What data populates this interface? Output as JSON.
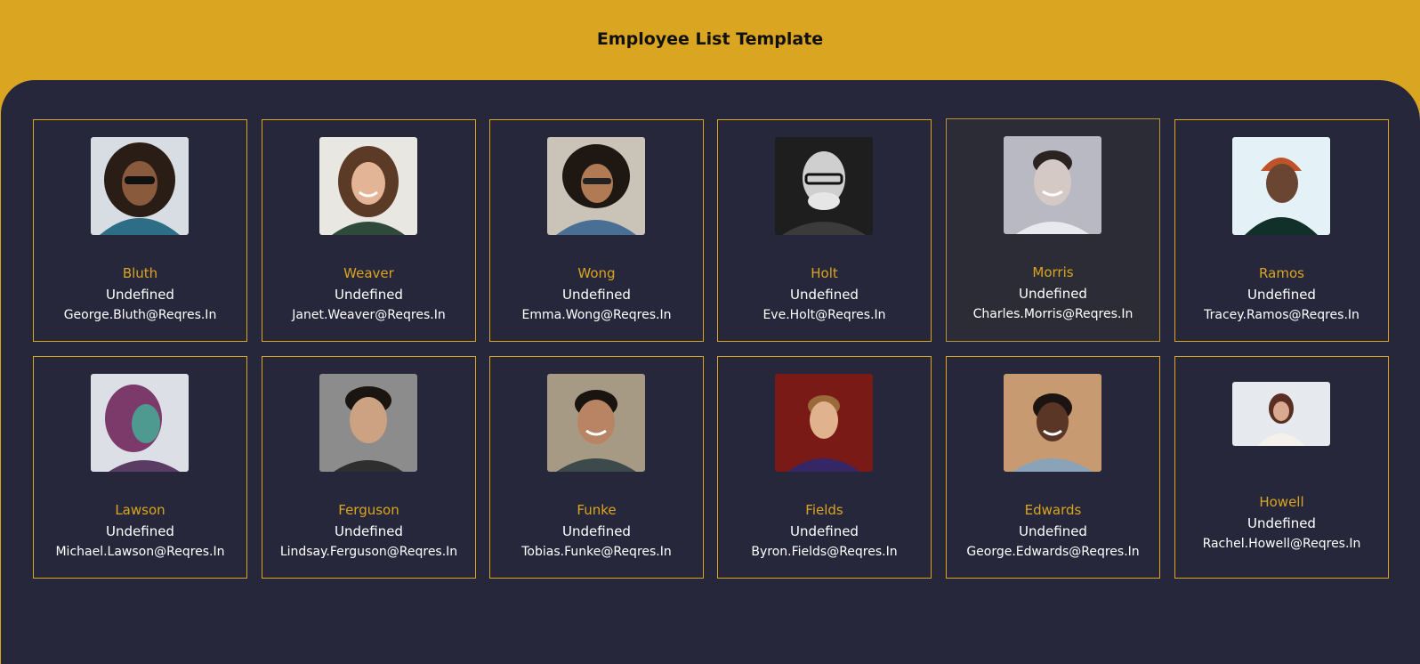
{
  "header": {
    "title": "Employee List Template"
  },
  "employees": [
    {
      "last_name": "Bluth",
      "role": "Undefined",
      "email": "George.Bluth@Reqres.In"
    },
    {
      "last_name": "Weaver",
      "role": "Undefined",
      "email": "Janet.Weaver@Reqres.In"
    },
    {
      "last_name": "Wong",
      "role": "Undefined",
      "email": "Emma.Wong@Reqres.In"
    },
    {
      "last_name": "Holt",
      "role": "Undefined",
      "email": "Eve.Holt@Reqres.In"
    },
    {
      "last_name": "Morris",
      "role": "Undefined",
      "email": "Charles.Morris@Reqres.In"
    },
    {
      "last_name": "Ramos",
      "role": "Undefined",
      "email": "Tracey.Ramos@Reqres.In"
    },
    {
      "last_name": "Lawson",
      "role": "Undefined",
      "email": "Michael.Lawson@Reqres.In"
    },
    {
      "last_name": "Ferguson",
      "role": "Undefined",
      "email": "Lindsay.Ferguson@Reqres.In"
    },
    {
      "last_name": "Funke",
      "role": "Undefined",
      "email": "Tobias.Funke@Reqres.In"
    },
    {
      "last_name": "Fields",
      "role": "Undefined",
      "email": "Byron.Fields@Reqres.In"
    },
    {
      "last_name": "Edwards",
      "role": "Undefined",
      "email": "George.Edwards@Reqres.In"
    },
    {
      "last_name": "Howell",
      "role": "Undefined",
      "email": "Rachel.Howell@Reqres.In"
    }
  ],
  "colors": {
    "accent": "#daa520",
    "background": "#27273b",
    "text": "#ffffff"
  },
  "icons": {
    "avatar": "person-photo"
  }
}
